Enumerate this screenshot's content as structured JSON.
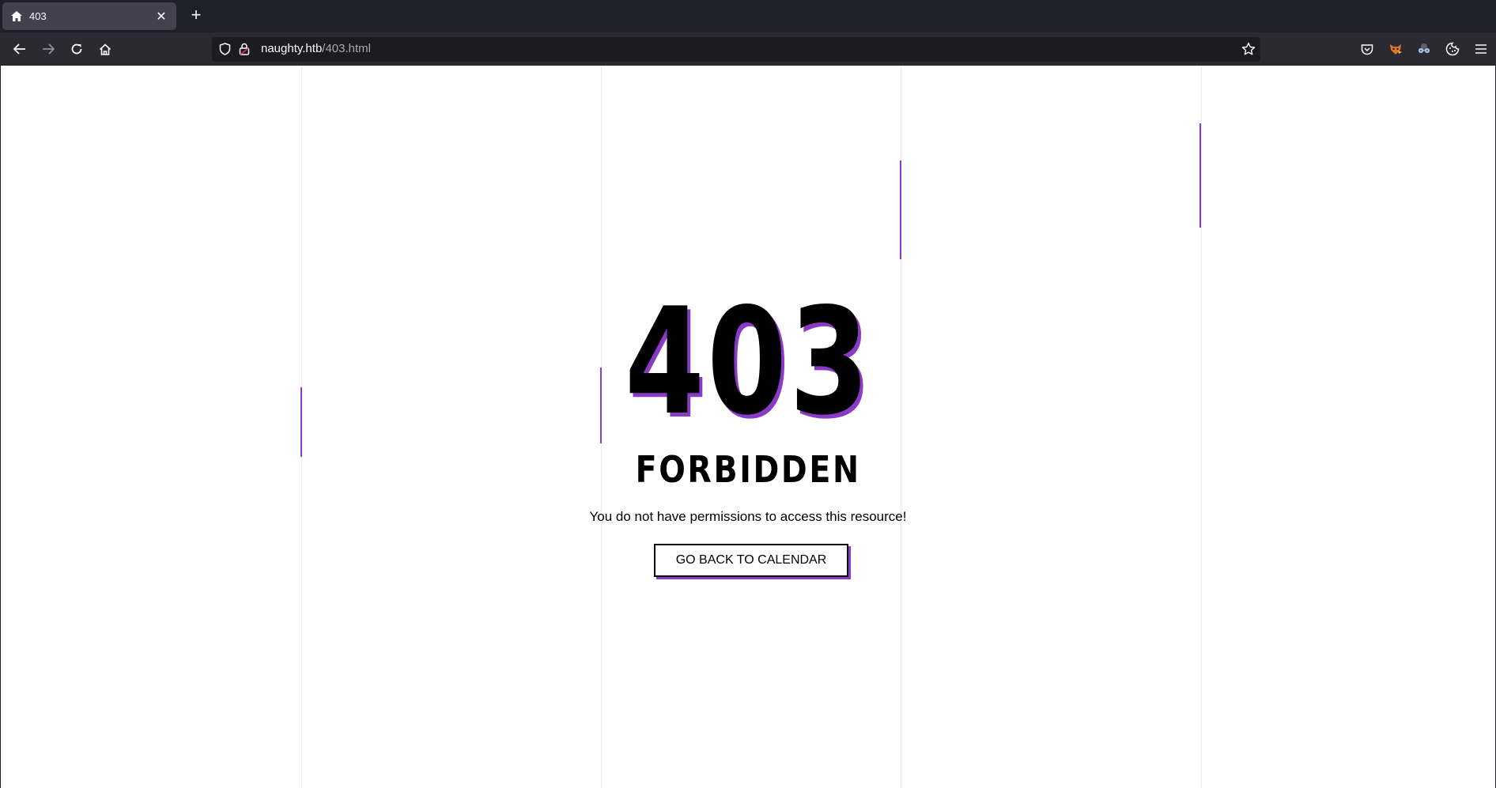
{
  "browser": {
    "tab": {
      "title": "403",
      "favicon": "home-icon"
    },
    "url": {
      "host": "naughty.htb",
      "path": "/403.html"
    },
    "nav_icons": [
      "back-icon",
      "forward-icon",
      "reload-icon",
      "home-icon"
    ],
    "toolbar_icons": [
      "pocket-icon",
      "extension-fox-icon",
      "extension-glasses-icon",
      "extension-cookie-icon",
      "menu-icon"
    ]
  },
  "page": {
    "error_code": "403",
    "error_title": "FORBIDDEN",
    "message": "You do not have permissions to access this resource!",
    "button_label": "GO BACK TO CALENDAR"
  },
  "colors": {
    "accent": "#8a3ac7",
    "text": "#000000",
    "background": "#ffffff"
  }
}
